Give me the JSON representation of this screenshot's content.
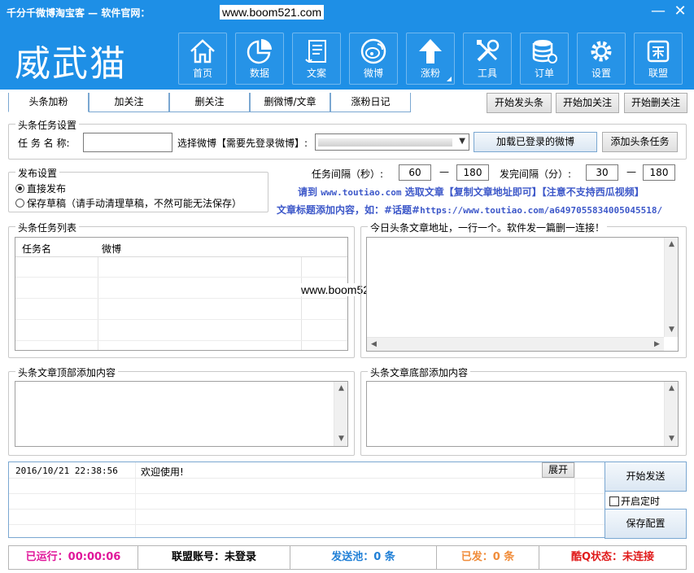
{
  "titlebar": {
    "title": "千分千微博淘宝客 — 软件官网：",
    "url": "www.boom521.com",
    "min": "—",
    "close": "✕"
  },
  "logo": "威武猫",
  "nav": [
    {
      "label": "首页",
      "icon": "home-icon"
    },
    {
      "label": "数据",
      "icon": "pie-chart-icon"
    },
    {
      "label": "文案",
      "icon": "scroll-icon"
    },
    {
      "label": "微博",
      "icon": "weibo-icon"
    },
    {
      "label": "涨粉",
      "icon": "arrow-up-icon"
    },
    {
      "label": "工具",
      "icon": "tools-icon"
    },
    {
      "label": "订单",
      "icon": "database-icon"
    },
    {
      "label": "设置",
      "icon": "gear-icon"
    },
    {
      "label": "联盟",
      "icon": "alliance-icon"
    }
  ],
  "tabs": [
    "头条加粉",
    "加关注",
    "删关注",
    "删微博/文章",
    "涨粉日记"
  ],
  "top_buttons": {
    "start_toutiao": "开始发头条",
    "start_follow": "开始加关注",
    "start_unfollow": "开始删关注"
  },
  "task_group": {
    "title": "头条任务设置",
    "name_label": "任 务 名 称:",
    "name_value": "",
    "weibo_label": "选择微博【需要先登录微博】:",
    "load_button": "加载已登录的微博",
    "add_button": "添加头条任务"
  },
  "publish_group": {
    "title": "发布设置",
    "option1": "直接发布",
    "option2": "保存草稿（请手动清理草稿，不然可能无法保存）"
  },
  "intervals": {
    "task_label": "任务间隔（秒）:",
    "task_min": "60",
    "task_max": "180",
    "dash": "—",
    "post_label": "发完间隔（分）:",
    "post_min": "30",
    "post_max": "180"
  },
  "hints": {
    "line1_a": "请到",
    "line1_url": "www.toutiao.com",
    "line1_b": "选取文章【复制文章地址即可】【注意不支持西瓜视频】",
    "line2_a": "文章标题添加内容，如：#话题#",
    "line2_url": "https://www.toutiao.com/a6497055834005045518/"
  },
  "task_list": {
    "title": "头条任务列表",
    "col_name": "任务名",
    "col_weibo": "微博"
  },
  "urls_box": {
    "title": "今日头条文章地址，一行一个。软件发一篇删一连接！"
  },
  "watermark": "www.boom521.com",
  "top_content": {
    "title": "头条文章顶部添加内容"
  },
  "bottom_content": {
    "title": "头条文章底部添加内容"
  },
  "log": {
    "time": "2016/10/21 22:38:56",
    "message": "欢迎使用!",
    "expand": "展开"
  },
  "side": {
    "start_send": "开始发送",
    "timer": "开启定时",
    "save_config": "保存配置"
  },
  "status": {
    "running": "已运行：00:00:06",
    "account": "联盟账号：未登录",
    "pool": "发送池：0 条",
    "sent": "已发：0 条",
    "qq": "酷Q状态：未连接"
  },
  "colors": {
    "brand": "#1e8fe6",
    "running": "#e0169a",
    "pool": "#1f7fd6",
    "sent": "#f08c3a",
    "qq": "#e01b1b",
    "hint": "#3d58c9"
  }
}
